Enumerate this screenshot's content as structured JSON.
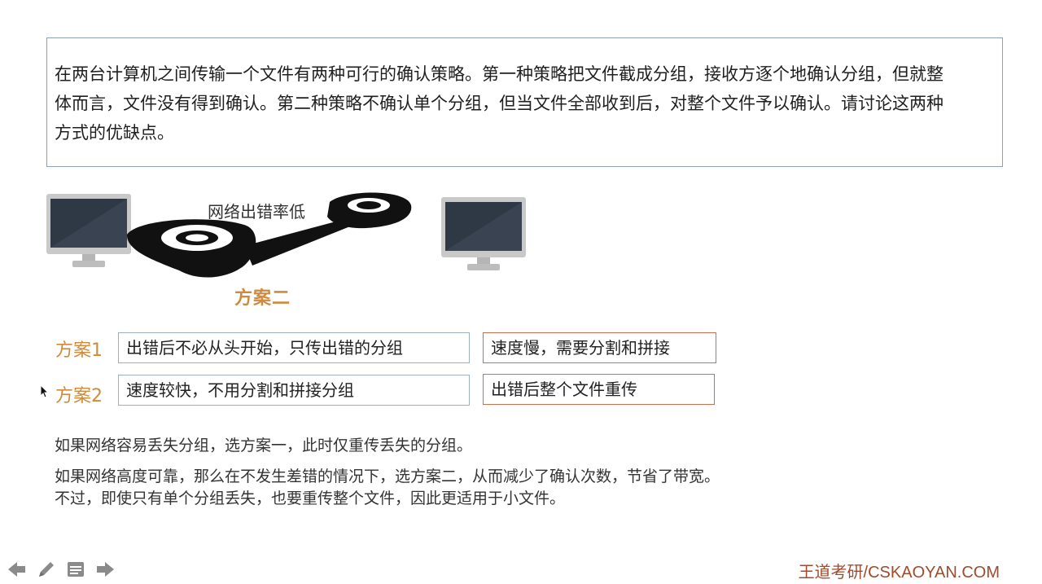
{
  "question": {
    "text": "在两台计算机之间传输一个文件有两种可行的确认策略。第一种策略把文件截成分组，接收方逐个地确认分组，但就整体而言，文件没有得到确认。第二种策略不确认单个分组，但当文件全部收到后，对整个文件予以确认。请讨论这两种方式的优缺点。"
  },
  "diagram": {
    "network_label": "网络出错率低",
    "scheme_title": "方案二",
    "left_monitor_icon": "monitor-icon",
    "right_monitor_icon": "monitor-icon",
    "tape_icon": "tape-reel-icon"
  },
  "comparison": {
    "rows": [
      {
        "label": "方案1",
        "pro": "出错后不必从头开始，只传出错的分组",
        "con": "速度慢，需要分割和拼接"
      },
      {
        "label": "方案2",
        "pro": "速度较快，不用分割和拼接分组",
        "con": "出错后整个文件重传"
      }
    ]
  },
  "conclusions": {
    "line1": "如果网络容易丢失分组，选方案一，此时仅重传丢失的分组。",
    "line2": "如果网络高度可靠，那么在不发生差错的情况下，选方案二，从而减少了确认次数，节省了带宽。",
    "line3": "不过，即使只有单个分组丢失，也要重传整个文件，因此更适用于小文件。"
  },
  "footer": {
    "brand": "王道考研/CSKAOYAN.COM",
    "controls": [
      "back-arrow-icon",
      "pen-icon",
      "notes-icon",
      "forward-arrow-icon"
    ]
  },
  "colors": {
    "accent_orange": "#d08a3e",
    "brand_red": "#a14a2c",
    "pro_border": "#9bb0c2",
    "con_border": "#c9714f"
  }
}
